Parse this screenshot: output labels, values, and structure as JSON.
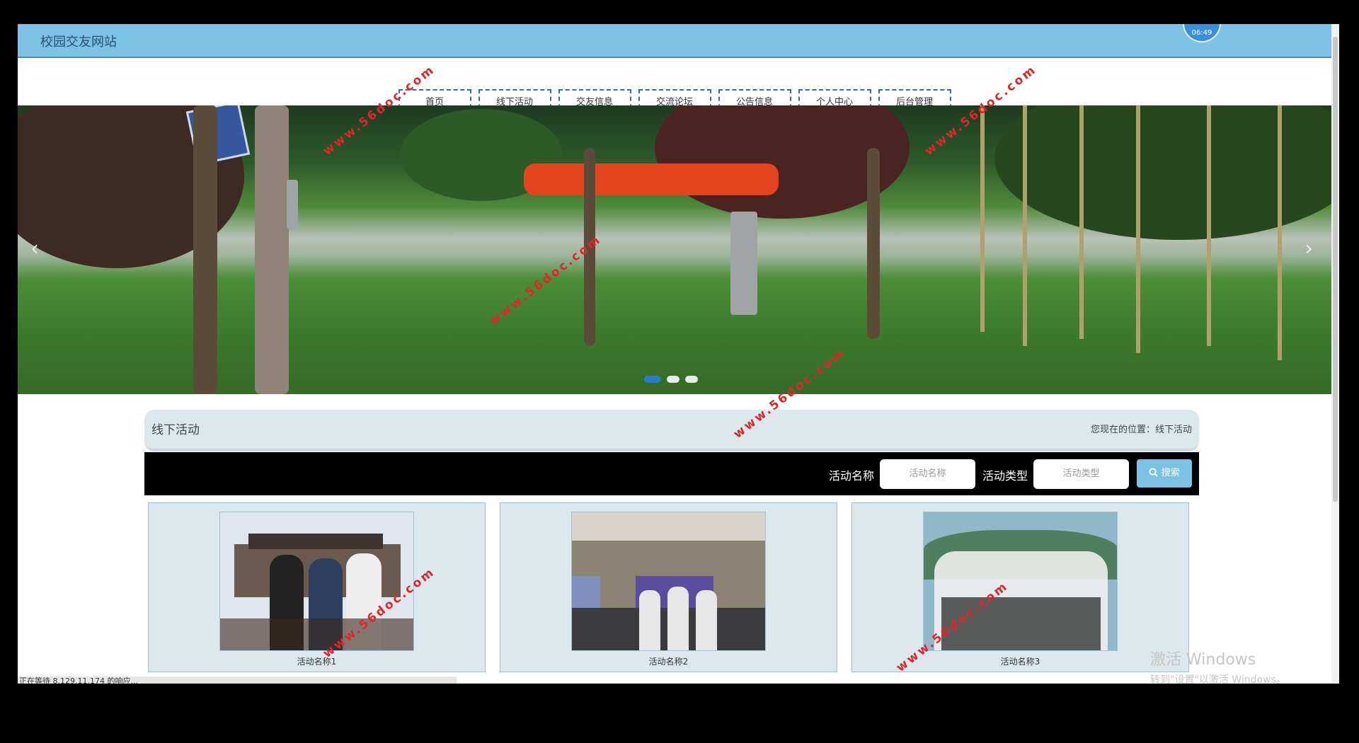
{
  "site": {
    "title": "校园交友网站",
    "clock": "06:49"
  },
  "nav": [
    {
      "label": "首页"
    },
    {
      "label": "线下活动"
    },
    {
      "label": "交友信息"
    },
    {
      "label": "交流论坛"
    },
    {
      "label": "公告信息"
    },
    {
      "label": "个人中心"
    },
    {
      "label": "后台管理"
    }
  ],
  "banner": {
    "prev": "‹",
    "next": "›",
    "slide_count": 3,
    "active_slide": 1
  },
  "breadcrumb": {
    "title": "线下活动",
    "location": "您现在的位置：线下活动"
  },
  "search": {
    "name_label": "活动名称",
    "name_placeholder": "活动名称",
    "type_label": "活动类型",
    "type_placeholder": "活动类型",
    "button": "搜索",
    "button_icon": "search-icon"
  },
  "activities": [
    {
      "caption": "活动名称1"
    },
    {
      "caption": "活动名称2"
    },
    {
      "caption": "活动名称3"
    }
  ],
  "status_url": "正在等待 8.129.11.174 的响应...",
  "watermark": "www.56doc.com",
  "windows": {
    "title": "激活 Windows",
    "subtitle": "转到\"设置\"以激活 Windows。"
  },
  "colors": {
    "accent": "#7cc2e4",
    "nav_border": "#3e6a96",
    "panel": "#dde8ec",
    "watermark": "#e0262a"
  }
}
